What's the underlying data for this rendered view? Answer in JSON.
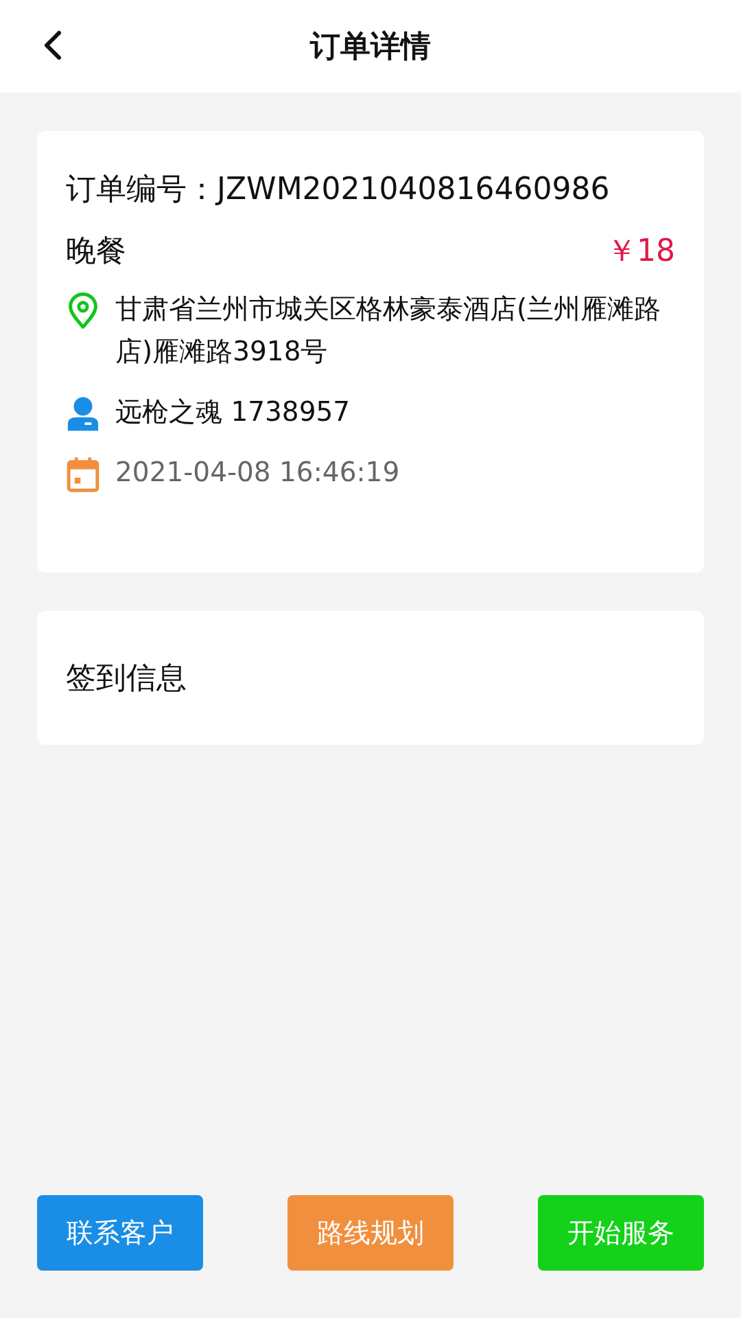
{
  "header": {
    "title": "订单详情"
  },
  "order": {
    "number_label": "订单编号：",
    "number": "JZWM2021040816460986",
    "meal": "晚餐",
    "price": "￥18",
    "details": [
      {
        "kind": "location",
        "text": "甘肃省兰州市城关区格林豪泰酒店(兰州雁滩路店)雁滩路3918号"
      },
      {
        "kind": "person",
        "text": "远枪之魂 1738957"
      },
      {
        "kind": "date",
        "text": "2021-04-08 16:46:19"
      }
    ]
  },
  "checkin": {
    "title": "签到信息"
  },
  "buttons": [
    {
      "label": "联系客户",
      "color": "#1a8de6"
    },
    {
      "label": "路线规划",
      "color": "#f0903f"
    },
    {
      "label": "开始服务",
      "color": "#14d11a"
    }
  ]
}
